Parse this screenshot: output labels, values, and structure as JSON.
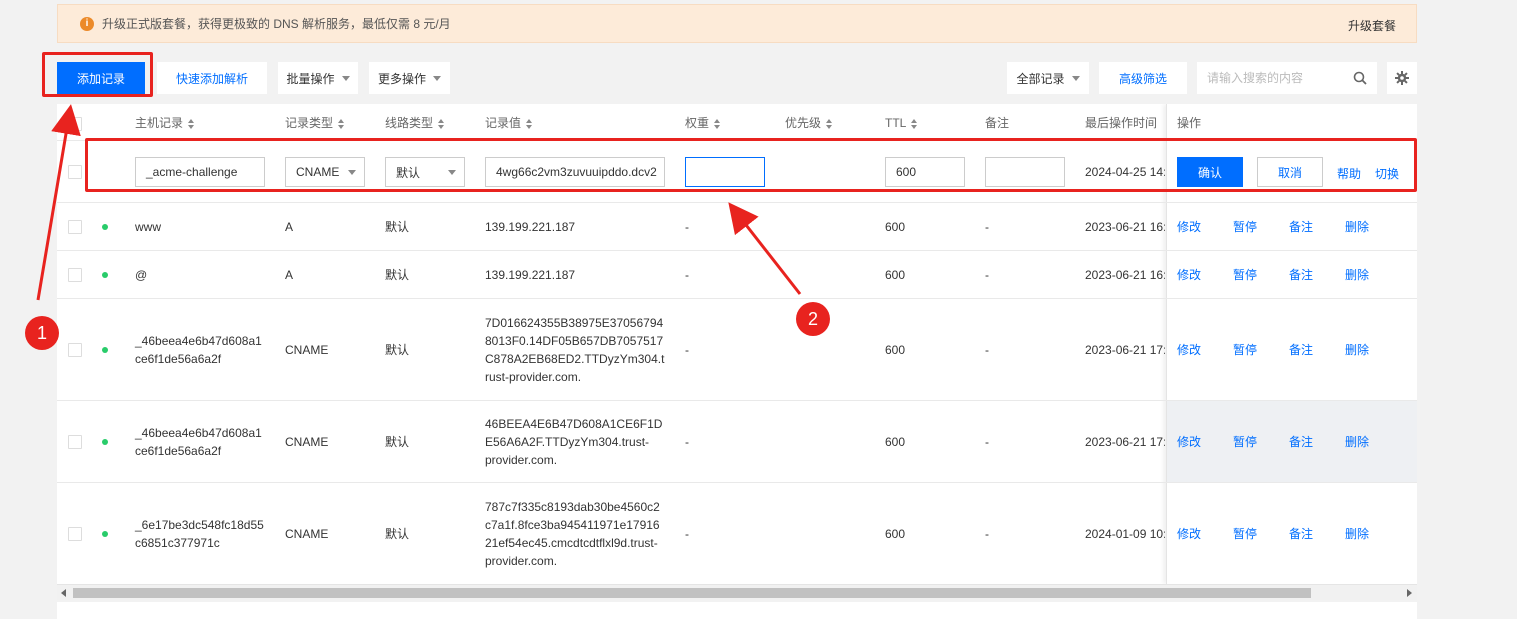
{
  "notice": {
    "text": "升级正式版套餐，获得更极致的 DNS 解析服务，最低仅需 8 元/月",
    "link": "升级套餐",
    "icon": "info-icon"
  },
  "toolbar": {
    "add_record": "添加记录",
    "quick_add": "快速添加解析",
    "batch": "批量操作",
    "more": "更多操作",
    "all_records": "全部记录",
    "advanced_filter": "高级筛选",
    "search_placeholder": "请输入搜索的内容"
  },
  "columns": {
    "host": "主机记录",
    "type": "记录类型",
    "line": "线路类型",
    "value": "记录值",
    "weight": "权重",
    "priority": "优先级",
    "ttl": "TTL",
    "remark": "备注",
    "last_op": "最后操作时间",
    "actions": "操作"
  },
  "edit_row": {
    "host": "_acme-challenge",
    "type": "CNAME",
    "line": "默认",
    "value": "4wg66c2vm3zuvuuipddo.dcv2",
    "weight": "",
    "ttl": "600",
    "remark": "",
    "time": "2024-04-25 14:",
    "confirm": "确认",
    "cancel": "取消",
    "help": "帮助",
    "switch": "切换"
  },
  "actions": {
    "modify": "修改",
    "pause": "暂停",
    "remark": "备注",
    "delete": "删除"
  },
  "rows": [
    {
      "host": "www",
      "type": "A",
      "line": "默认",
      "value": "139.199.221.187",
      "weight": "-",
      "ttl": "600",
      "remark": "-",
      "time": "2023-06-21 16:"
    },
    {
      "host": "@",
      "type": "A",
      "line": "默认",
      "value": "139.199.221.187",
      "weight": "-",
      "ttl": "600",
      "remark": "-",
      "time": "2023-06-21 16:"
    },
    {
      "host": "_46beea4e6b47d608a1\nce6f1de56a6a2f",
      "type": "CNAME",
      "line": "默认",
      "value": "7D016624355B38975E37056794\n8013F0.14DF05B657DB7057517\nC878A2EB68ED2.TTDyzYm304.t\nrust-provider.com.",
      "weight": "-",
      "ttl": "600",
      "remark": "-",
      "time": "2023-06-21 17:"
    },
    {
      "host": "_46beea4e6b47d608a1\nce6f1de56a6a2f",
      "type": "CNAME",
      "line": "默认",
      "value": "46BEEA4E6B47D608A1CE6F1D\nE56A6A2F.TTDyzYm304.trust-\nprovider.com.",
      "weight": "-",
      "ttl": "600",
      "remark": "-",
      "time": "2023-06-21 17:"
    },
    {
      "host": "_6e17be3dc548fc18d55\nc6851c377971c",
      "type": "CNAME",
      "line": "默认",
      "value": "787c7f335c8193dab30be4560c2\nc7a1f.8fce3ba945411971e17916\n21ef54ec45.cmcdtcdtflxl9d.trust-\nprovider.com.",
      "weight": "-",
      "ttl": "600",
      "remark": "-",
      "time": "2024-01-09 10:"
    }
  ],
  "annotations": {
    "badge1": "1",
    "badge2": "2"
  },
  "colors": {
    "primary": "#006eff",
    "annotation_red": "#e8231f",
    "status_green": "#29cc6a",
    "notice_bg": "#fdebd9"
  }
}
